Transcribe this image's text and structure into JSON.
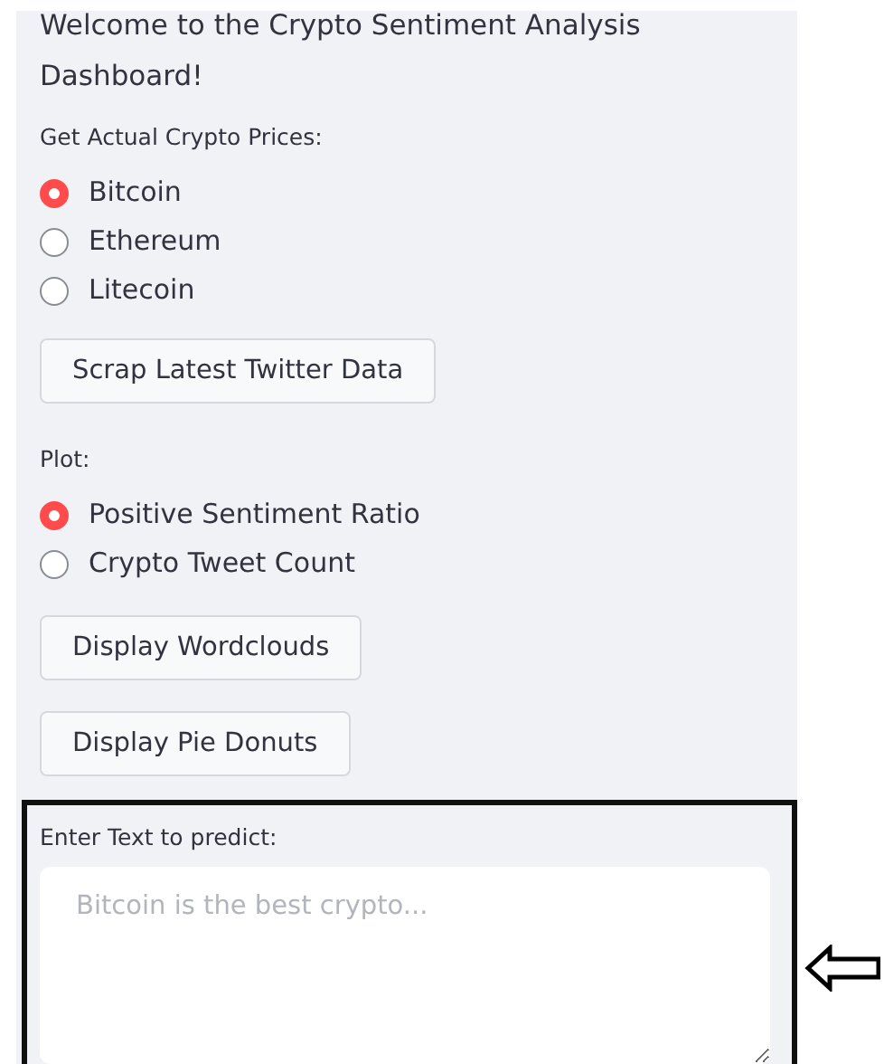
{
  "sidebar": {
    "welcome": "Welcome to the Crypto Sentiment Analysis Dashboard!",
    "prices": {
      "label": "Get Actual Crypto Prices:",
      "options": [
        {
          "label": "Bitcoin",
          "selected": true
        },
        {
          "label": "Ethereum",
          "selected": false
        },
        {
          "label": "Litecoin",
          "selected": false
        }
      ]
    },
    "scrape_button": "Scrap Latest Twitter Data",
    "plot": {
      "label": "Plot:",
      "options": [
        {
          "label": "Positive Sentiment Ratio",
          "selected": true
        },
        {
          "label": "Crypto Tweet Count",
          "selected": false
        }
      ]
    },
    "buttons": [
      "Display Wordclouds",
      "Display Pie Donuts"
    ],
    "predict": {
      "label": "Enter Text to predict:",
      "placeholder": "Bitcoin is the best crypto..."
    }
  }
}
